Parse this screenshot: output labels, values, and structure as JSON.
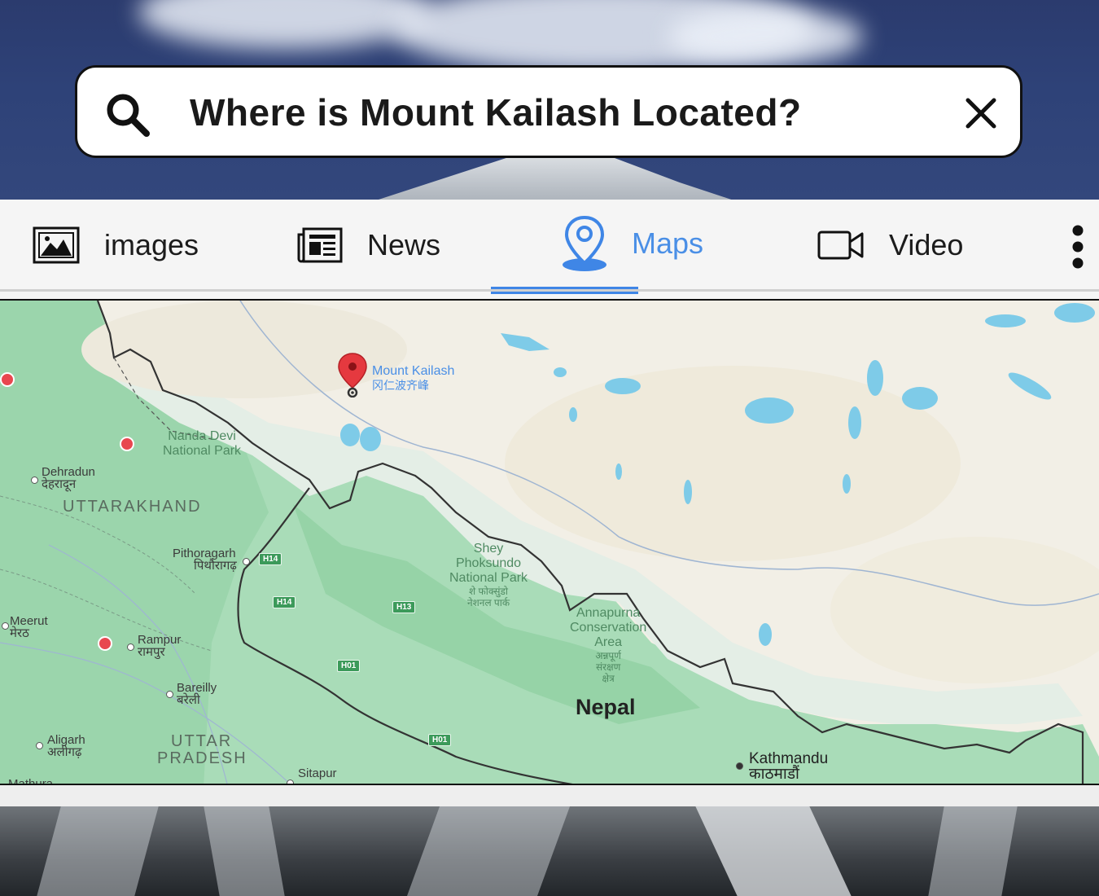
{
  "search": {
    "query": "Where is Mount Kailash Located?",
    "search_icon": "search-icon",
    "clear_icon": "close-icon"
  },
  "tabs": [
    {
      "label": "images",
      "icon": "image-icon",
      "active": false
    },
    {
      "label": "News",
      "icon": "newspaper-icon",
      "active": false
    },
    {
      "label": "Maps",
      "icon": "location-pin-icon",
      "active": true
    },
    {
      "label": "Video",
      "icon": "video-camera-icon",
      "active": false
    }
  ],
  "more_icon": "more-vertical-icon",
  "colors": {
    "accent": "#3f86e6",
    "active_tab_text": "#4a8fe6",
    "pin": "#e5393f"
  },
  "map": {
    "marker": {
      "name": "Mount Kailash",
      "name_local": "冈仁波齐峰"
    },
    "regions": [
      "UTTARAKHAND",
      "UTTAR",
      "PRADESH"
    ],
    "country": "Nepal",
    "parks": {
      "nanda_devi": [
        "Nanda Devi",
        "National Park"
      ],
      "shey": [
        "Shey",
        "Phoksundo",
        "National Park",
        "शे फोक्सुंडो",
        "नेशनल पार्क"
      ],
      "annapurna": [
        "Annapurna",
        "Conservation",
        "Area",
        "अन्नपूर्ण",
        "संरक्षण",
        "क्षेत्र"
      ]
    },
    "cities": {
      "dehradun": [
        "Dehradun",
        "देहरादून"
      ],
      "pithoragarh": [
        "Pithoragarh",
        "पिथौरागढ़"
      ],
      "meerut": [
        "Meerut",
        "मेरठ"
      ],
      "rampur": [
        "Rampur",
        "रामपुर"
      ],
      "bareilly": [
        "Bareilly",
        "बरेली"
      ],
      "aligarh": [
        "Aligarh",
        "अलीगढ़"
      ],
      "sitapur": [
        "Sitapur"
      ],
      "mathura": [
        "Mathura"
      ],
      "kathmandu": [
        "Kathmandu",
        "काठमाडौं"
      ]
    },
    "roads": [
      "H14",
      "H14",
      "H13",
      "H01",
      "H01"
    ]
  }
}
